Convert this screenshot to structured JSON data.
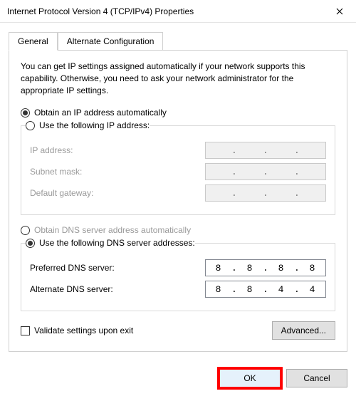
{
  "window": {
    "title": "Internet Protocol Version 4 (TCP/IPv4) Properties"
  },
  "tabs": {
    "general": "General",
    "alternate": "Alternate Configuration"
  },
  "description": "You can get IP settings assigned automatically if your network supports this capability. Otherwise, you need to ask your network administrator for the appropriate IP settings.",
  "ip": {
    "auto_label": "Obtain an IP address automatically",
    "manual_label": "Use the following IP address:",
    "auto_selected": true,
    "fields": {
      "ip_label": "IP address:",
      "mask_label": "Subnet mask:",
      "gateway_label": "Default gateway:"
    },
    "values": {
      "ip": [
        "",
        "",
        "",
        ""
      ],
      "mask": [
        "",
        "",
        "",
        ""
      ],
      "gateway": [
        "",
        "",
        "",
        ""
      ]
    }
  },
  "dns": {
    "auto_label": "Obtain DNS server address automatically",
    "manual_label": "Use the following DNS server addresses:",
    "manual_selected": true,
    "fields": {
      "preferred_label": "Preferred DNS server:",
      "alternate_label": "Alternate DNS server:"
    },
    "values": {
      "preferred": [
        "8",
        "8",
        "8",
        "8"
      ],
      "alternate": [
        "8",
        "8",
        "4",
        "4"
      ]
    }
  },
  "validate_label": "Validate settings upon exit",
  "validate_checked": false,
  "buttons": {
    "advanced": "Advanced...",
    "ok": "OK",
    "cancel": "Cancel"
  }
}
